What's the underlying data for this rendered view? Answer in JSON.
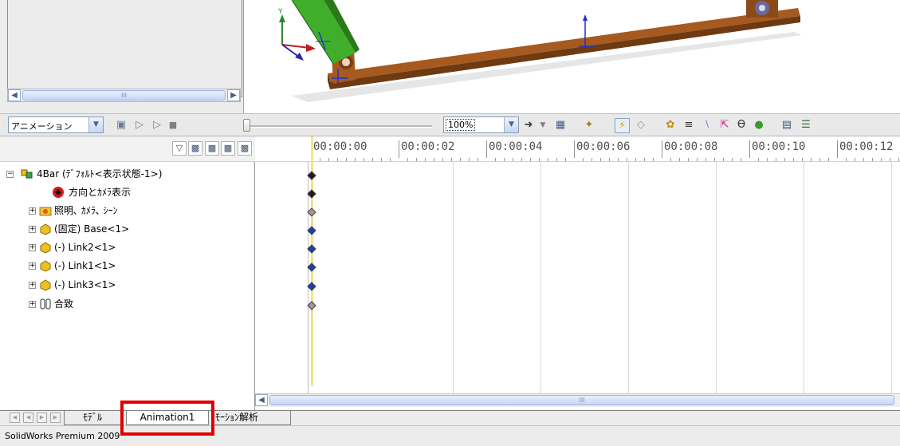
{
  "toolbar": {
    "study_type": "アニメーション",
    "zoom_value": "100%"
  },
  "tree": {
    "root": "4Bar (ﾃﾞﾌｫﾙﾄ<表示状態-1>)",
    "items": [
      "方向とｶﾒﾗ表示",
      "照明､ ｶﾒﾗ､ ｼｰﾝ",
      "(固定) Base<1>",
      "(-) Link2<1>",
      "(-) Link1<1>",
      "(-) Link3<1>",
      "合致"
    ]
  },
  "timeline": {
    "labels": [
      "00:00:00",
      "00:00:02",
      "00:00:04",
      "00:00:06",
      "00:00:08",
      "00:00:10",
      "00:00:12"
    ],
    "playhead_time": "00:00:00"
  },
  "tabs": {
    "model": "ﾓﾃﾞﾙ",
    "animation": "Animation1",
    "motion": "ﾓｰｼｮﾝ解析"
  },
  "status": {
    "text": "SolidWorks Premium 2009"
  },
  "colors": {
    "playhead": "#f3e58a",
    "highlight": "#e00000",
    "key_dark": "#1c1c1c",
    "key_blue": "#1f3fa8",
    "key_gray": "#9a9a9a",
    "base_part": "#9a4a17",
    "link_part": "#3fae2a"
  }
}
